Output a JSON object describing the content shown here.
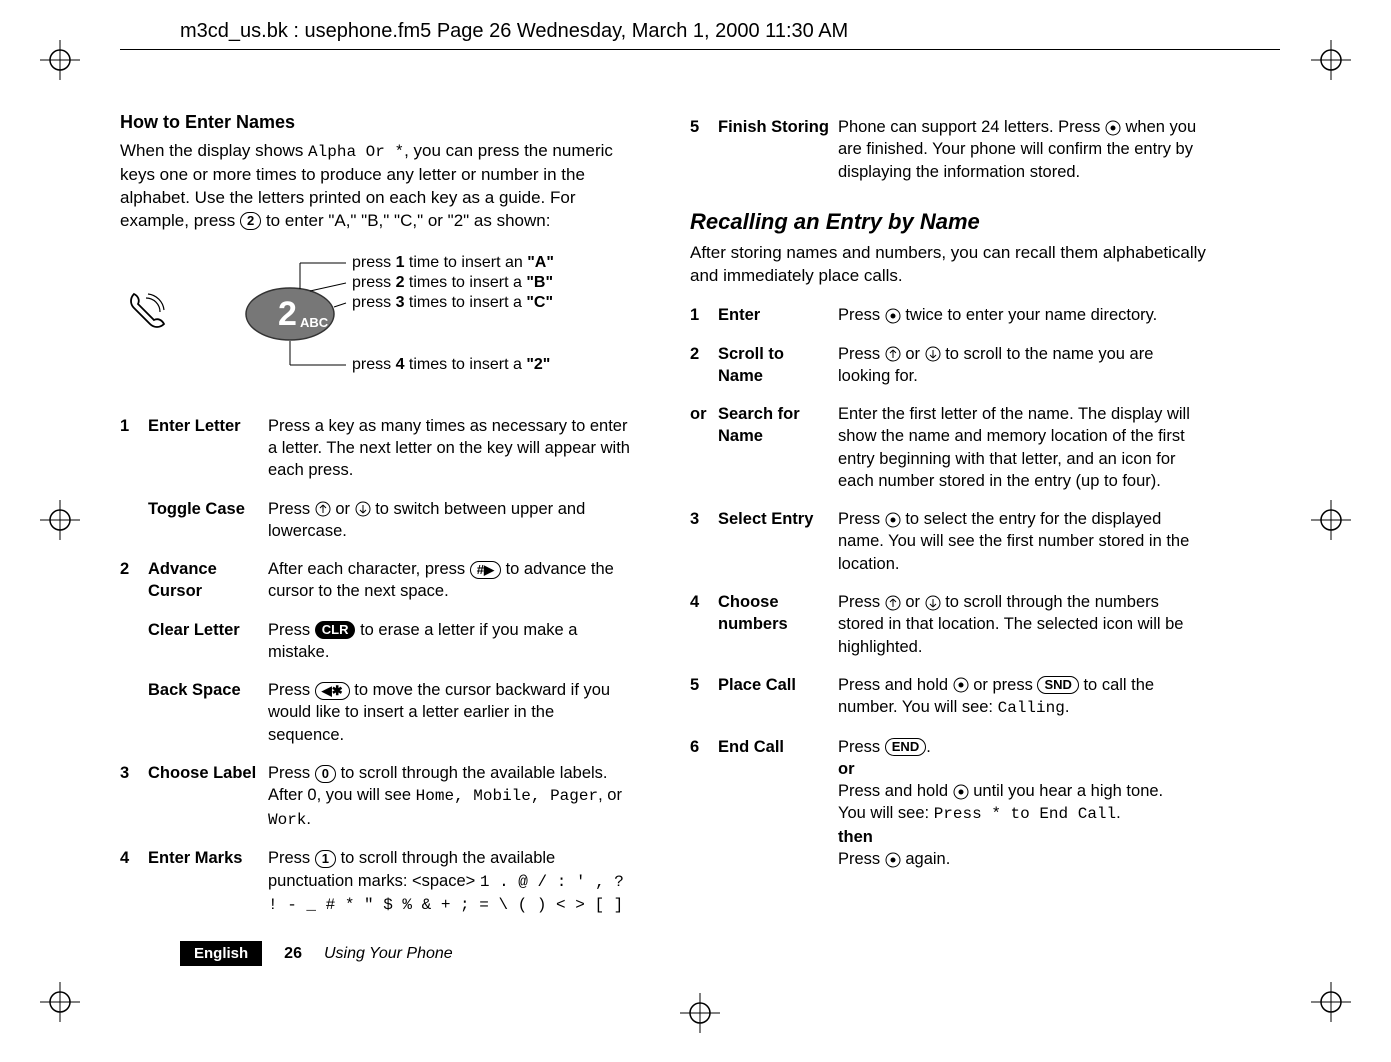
{
  "header": "m3cd_us.bk : usephone.fm5  Page 26  Wednesday, March 1, 2000  11:30 AM",
  "left": {
    "subhead": "How to Enter Names",
    "intro_a": "When the display shows ",
    "intro_alpha": "Alpha Or *",
    "intro_b": ", you can press the numeric keys one or more times to produce any letter or number in the alphabet. Use the letters printed on each key as a guide. For example, press ",
    "intro_key": "2",
    "intro_c": " to enter \"A,\" \"B,\" \"C,\" or \"2\" as shown:",
    "diagram": {
      "line1a": "press ",
      "line1b": "1",
      "line1c": " time to insert an ",
      "line1d": "\"A\"",
      "line2a": "press ",
      "line2b": "2",
      "line2c": " times to insert a ",
      "line2d": "\"B\"",
      "line3a": "press ",
      "line3b": "3",
      "line3c": " times to insert a ",
      "line3d": "\"C\"",
      "line4a": "press ",
      "line4b": "4",
      "line4c": " times to insert a ",
      "line4d": "\"2\"",
      "key_big": "2",
      "key_small": "ABC"
    },
    "steps": [
      {
        "n": "1",
        "label": "Enter Letter",
        "desc": "Press a key as many times as necessary to enter a letter. The next letter on the key will appear with each press."
      },
      {
        "n": "",
        "label": "Toggle Case",
        "desc": "Press AUP or ADN to switch between upper and lowercase."
      },
      {
        "n": "2",
        "label": "Advance Cursor",
        "desc_a": "After each character, press ",
        "key": "#▶",
        "desc_b": " to advance the cursor to the next space."
      },
      {
        "n": "",
        "label": "Clear Letter",
        "desc_a": "Press ",
        "key": "CLR",
        "desc_b": " to erase a letter if you make a mistake."
      },
      {
        "n": "",
        "label": "Back Space",
        "desc_a": "Press ",
        "key": "◀✱",
        "desc_b": " to move the cursor backward if you would like to insert a letter earlier in the sequence."
      },
      {
        "n": "3",
        "label": "Choose Label",
        "desc_a": "Press ",
        "key": "0",
        "desc_b": " to scroll through the available labels. After 0, you will see ",
        "mono": "Home, Mobile, Pager",
        "desc_c": ", or ",
        "mono2": "Work",
        "desc_d": "."
      },
      {
        "n": "4",
        "label": "Enter Marks",
        "desc_a": "Press ",
        "key": "1",
        "desc_b": " to scroll through the available punctuation marks: <space>  ",
        "mono": "1 . @ / : ' , ? ! - _ # * \" $ % & + ; = \\ ( ) < > [ ]"
      }
    ]
  },
  "right": {
    "topstep": {
      "n": "5",
      "label": "Finish Storing",
      "desc": "Phone can support 24 letters. Press AOK when you are finished. Your phone will confirm the entry by displaying the information stored."
    },
    "section": "Recalling an Entry by Name",
    "intro": "After storing names and numbers, you can recall them alphabetically and immediately place calls.",
    "steps": [
      {
        "n": "1",
        "label": "Enter",
        "desc": "Press AOK twice to enter your name directory."
      },
      {
        "n": "2",
        "label": "Scroll to Name",
        "desc": "Press AUP or ADN to scroll to the name you are looking for."
      },
      {
        "n": "or",
        "label": "Search for Name",
        "desc": "Enter the first letter of the name. The display will show the name and memory location of the first entry beginning with that letter, and an icon for each number stored in the entry (up to four)."
      },
      {
        "n": "3",
        "label": "Select Entry",
        "desc": "Press AOK to select the entry for the displayed name. You will see the first number stored in the location."
      },
      {
        "n": "4",
        "label": "Choose numbers",
        "desc": "Press AUP or ADN to scroll through the numbers stored in that location. The selected icon will be highlighted."
      },
      {
        "n": "5",
        "label": "Place Call",
        "desc_a": "Press and hold AOK or press ",
        "key": "SND",
        "desc_b": " to call the number. You will see: ",
        "mono": "Calling",
        "desc_c": "."
      },
      {
        "n": "6",
        "label": "End Call",
        "desc_a": "Press ",
        "key": "END",
        "desc_b": ".",
        "or": "or",
        "desc_c": "Press and hold AOK until you hear a high tone.",
        "desc_d": "You will see: ",
        "mono": "Press * to End Call",
        "desc_e": ".",
        "then": "then",
        "desc_f": "Press AOK again."
      }
    ]
  },
  "footer": {
    "lang": "English",
    "page": "26",
    "title": "Using Your Phone"
  }
}
